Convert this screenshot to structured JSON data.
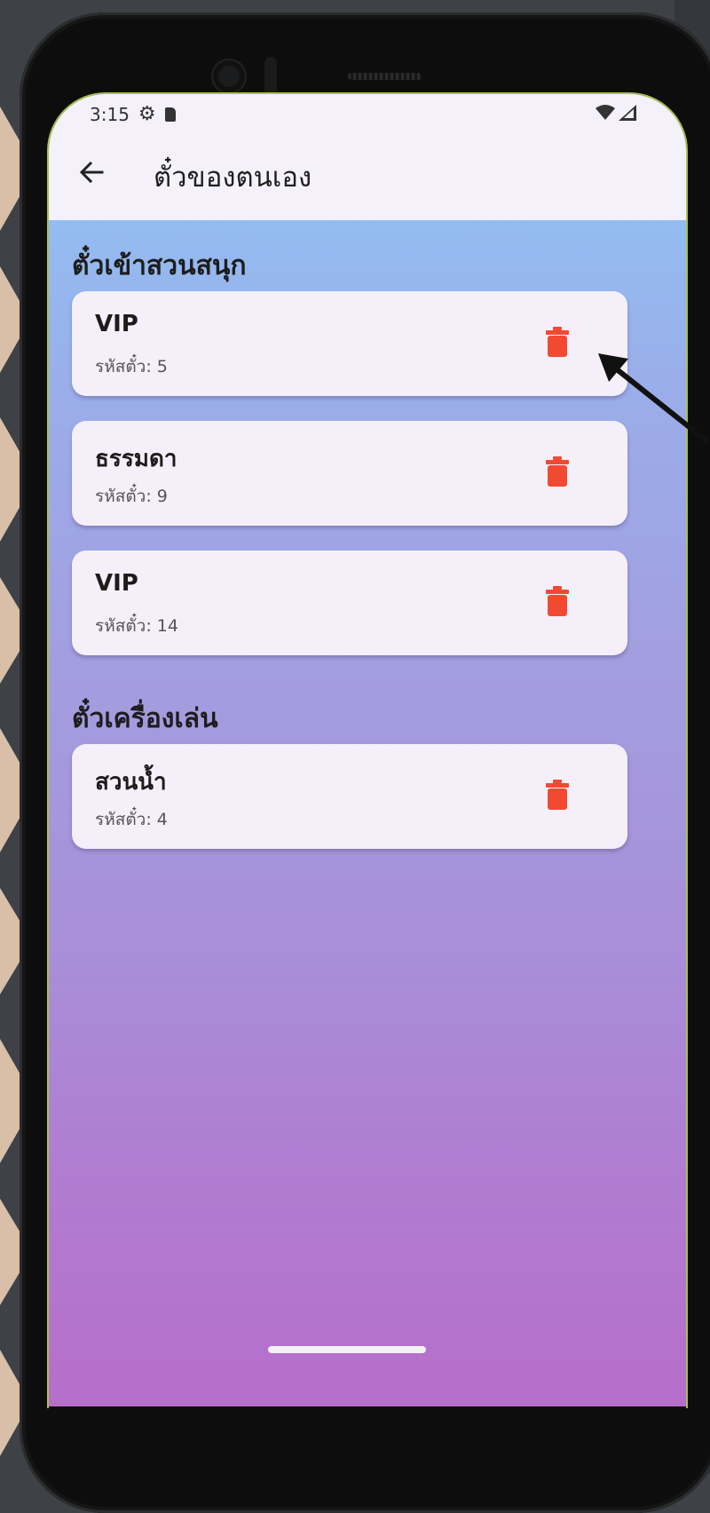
{
  "status_bar": {
    "time": "3:15"
  },
  "app_bar": {
    "back_icon": "arrow-left-icon",
    "title": "ตั๋วของตนเอง"
  },
  "sections": [
    {
      "title": "ตั๋วเข้าสวนสนุก",
      "tickets": [
        {
          "name": "VIP",
          "code_label": "รหัสตั๋ว: 5"
        },
        {
          "name": "ธรรมดา",
          "code_label": "รหัสตั๋ว: 9"
        },
        {
          "name": "VIP",
          "code_label": "รหัสตั๋ว: 14"
        }
      ]
    },
    {
      "title": "ตั๋วเครื่องเล่น",
      "tickets": [
        {
          "name": "สวนน้ำ",
          "code_label": "รหัสตั๋ว: 4"
        }
      ]
    }
  ],
  "colors": {
    "delete_icon": "#f24a32",
    "card_background": "#f4eff9",
    "topbar_background": "#f4f1fb",
    "gradient_top": "#8ec7f6",
    "gradient_bottom": "#b66ecb"
  },
  "icons": {
    "delete": "trash-icon",
    "annotation": "pointer-arrow-icon"
  }
}
